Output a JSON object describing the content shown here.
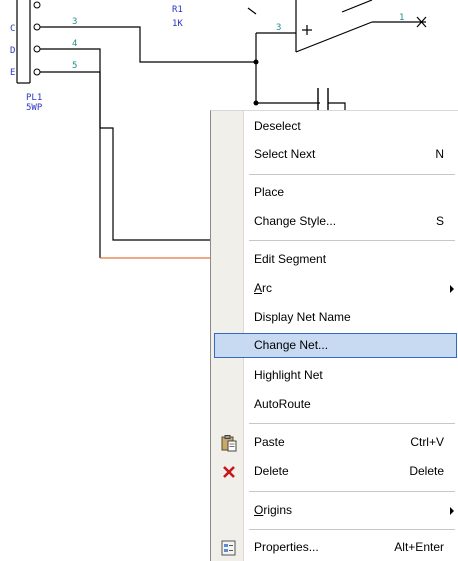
{
  "schematic": {
    "pin_labels": [
      "C",
      "D",
      "E"
    ],
    "pin_numbers": [
      "3",
      "4",
      "5"
    ],
    "connector_ref": "PL1",
    "connector_type": "5WP",
    "resistor_ref_partial": "R1",
    "resistor_value": "1K",
    "opamp_pin_in": "3",
    "opamp_pin_out": "1",
    "opamp_plus": "+",
    "colors": {
      "wire": "#000000",
      "highlight_wire": "#e8763a",
      "label_blue": "#2b36c6",
      "pin_number": "#1f8f8f"
    }
  },
  "menu": {
    "deselect": "Deselect",
    "select_next": "Select Next",
    "select_next_key": "N",
    "place": "Place",
    "change_style": "Change Style...",
    "change_style_key": "S",
    "edit_segment": "Edit Segment",
    "arc_prefix": "A",
    "arc_rest": "rc",
    "display_net_name": "Display Net Name",
    "change_net": "Change Net...",
    "highlight_net": "Highlight Net",
    "autoroute": "AutoRoute",
    "paste": "Paste",
    "paste_key": "Ctrl+V",
    "delete": "Delete",
    "delete_key": "Delete",
    "origins_prefix": "O",
    "origins_rest": "rigins",
    "properties": "Properties...",
    "properties_key": "Alt+Enter",
    "icons": {
      "paste": "clipboard-icon",
      "delete": "red-x-icon",
      "properties": "properties-icon",
      "submenu": "chevron-right-icon"
    },
    "highlight_color": "#c8d9f2"
  }
}
